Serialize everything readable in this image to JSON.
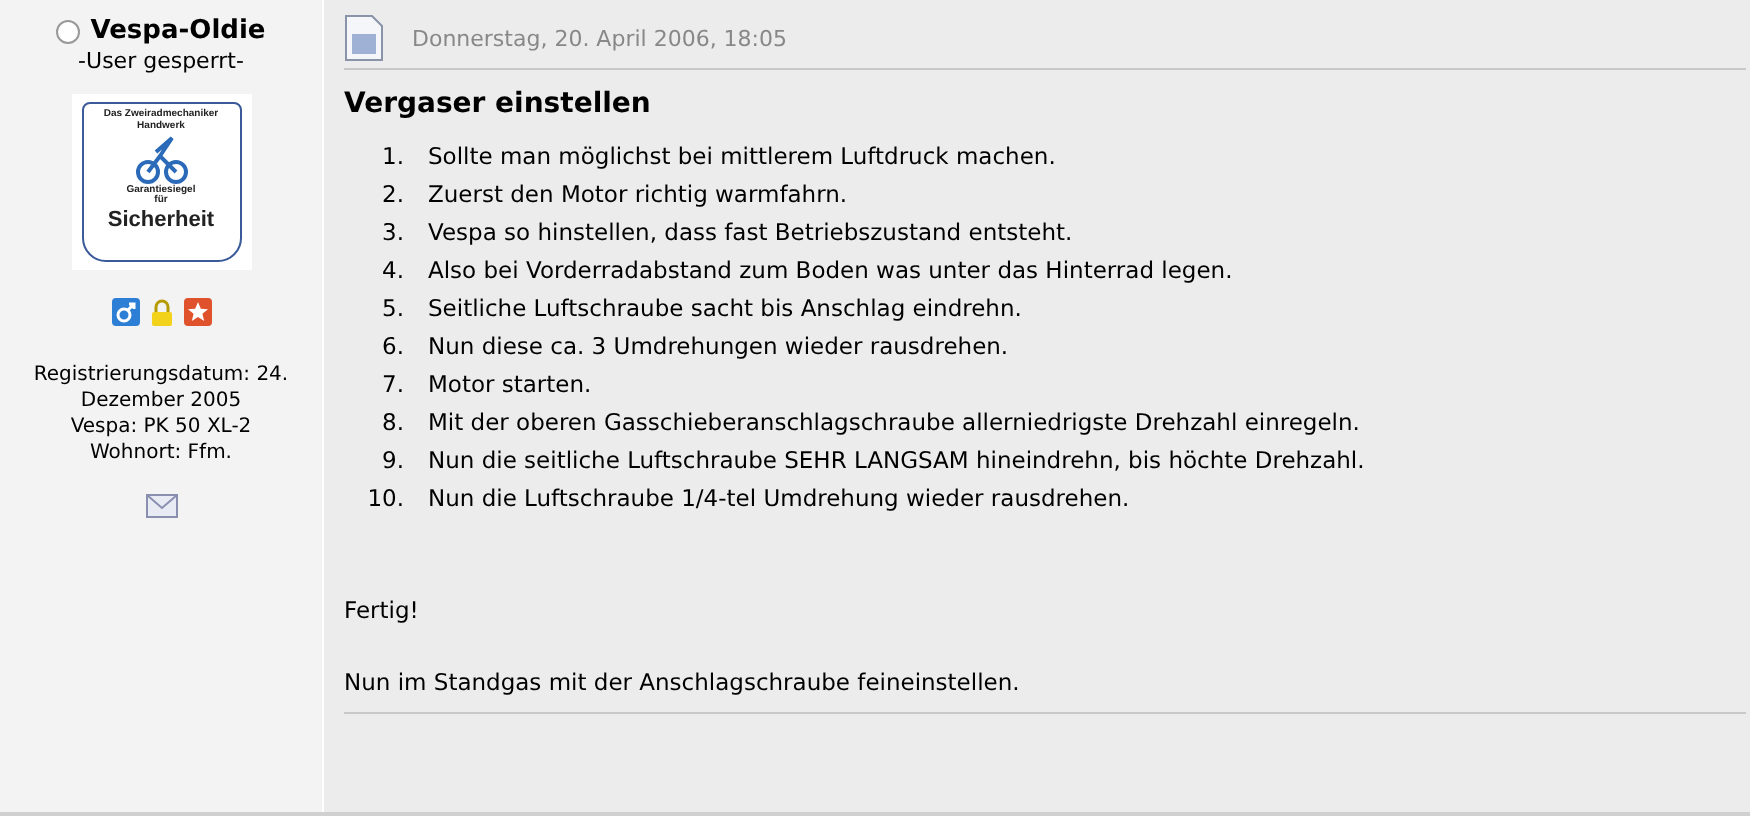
{
  "author": {
    "name": "Vespa-Oldie",
    "online": false,
    "status": "-User gesperrt-",
    "avatar": {
      "lines": [
        "Das Zweiradmechaniker",
        "Handwerk",
        "Garantiesiegel",
        "für",
        "Sicherheit"
      ]
    },
    "info": [
      "Registrierungsdatum: 24. Dezember 2005",
      "Vespa: PK 50 XL-2",
      "Wohnort: Ffm."
    ]
  },
  "post": {
    "date": "Donnerstag, 20. April 2006, 18:05",
    "title": "Vergaser einstellen",
    "steps": [
      {
        "number": "1.",
        "text": "Sollte man möglichst bei mittlerem Luftdruck machen."
      },
      {
        "number": "2.",
        "text": "Zuerst den Motor richtig warmfahrn."
      },
      {
        "number": "3.",
        "text": "Vespa so hinstellen, dass fast Betriebszustand entsteht."
      },
      {
        "number": "4.",
        "text": "Also bei Vorderradabstand zum Boden was unter das Hinterrad legen."
      },
      {
        "number": "5.",
        "text": "Seitliche Luftschraube sacht bis Anschlag eindrehn."
      },
      {
        "number": "6.",
        "text": "Nun diese ca. 3 Umdrehungen wieder rausdrehen."
      },
      {
        "number": "7.",
        "text": "Motor starten."
      },
      {
        "number": "8.",
        "text": "Mit der oberen Gasschieberanschlagschraube allerniedrigste Drehzahl einregeln."
      },
      {
        "number": "9.",
        "text": "Nun die seitliche Luftschraube SEHR LANGSAM hineindrehn, bis höchte Drehzahl."
      },
      {
        "number": "10.",
        "text": "Nun die Luftschraube 1/4-tel Umdrehung wieder rausdrehen."
      }
    ],
    "paragraphs": [
      "Fertig!",
      "Nun im Standgas mit der Anschlagschraube feineinstellen."
    ]
  }
}
